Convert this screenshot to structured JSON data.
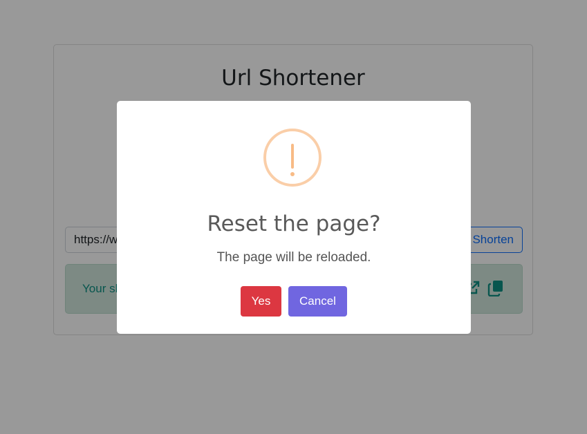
{
  "page": {
    "title": "Url Shortener",
    "url_input_value": "https://www.",
    "shorten_label": "Shorten",
    "result_text": "Your short link:"
  },
  "modal": {
    "title": "Reset the page?",
    "text": "The page will be reloaded.",
    "confirm_label": "Yes",
    "cancel_label": "Cancel",
    "icon": "warning-icon"
  },
  "colors": {
    "confirm": "#dc3741",
    "cancel": "#7066e0",
    "warning": "#f8bb86",
    "shorten_accent": "#0d6efd",
    "result_bg": "#d1e7dd"
  }
}
